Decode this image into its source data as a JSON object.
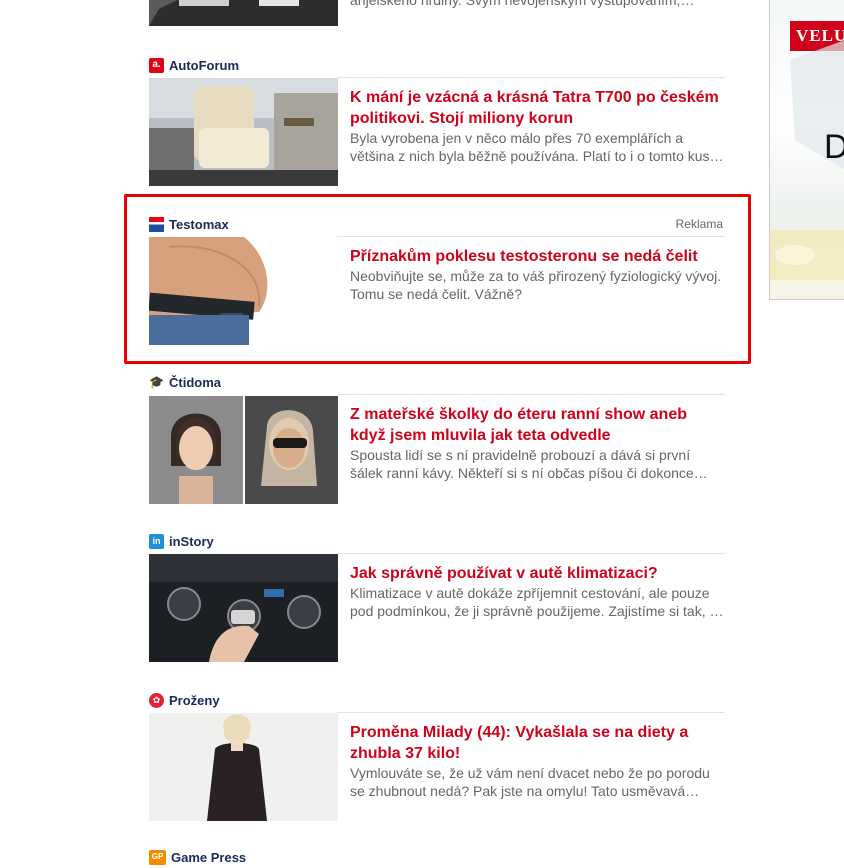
{
  "articles": [
    {
      "source": "",
      "title": "",
      "perex": "anjelského hrdiny. Svým nevojenským vystupováním, lasko…"
    },
    {
      "source": "AutoForum",
      "title": "K mání je vzácná a krásná Tatra T700 po českém politikovi. Stojí miliony korun",
      "perex": "Byla vyrobena jen v něco málo přes 70 exemplářích a většina z nich byla běžně používána. Platí to i o tomto kus…"
    },
    {
      "source": "Testomax",
      "ad_label": "Reklama",
      "title": "Příznakům poklesu testosteronu se nedá čelit",
      "perex": "Neobviňujte se, může za to váš přirozený fyziologický vývoj. Tomu se nedá čelit. Vážně?"
    },
    {
      "source": "Čtidoma",
      "title": "Z mateřské školky do éteru ranní show aneb když jsem mluvila jak teta odvedle",
      "perex": "Spousta lidí se s ní pravidelně probouzí a dává si první šálek ranní kávy. Někteří si s ní občas píšou či dokonce…"
    },
    {
      "source": "inStory",
      "title": "Jak správně používat v autě klimatizaci?",
      "perex": "Klimatizace v autě dokáže zpříjemnit cestování, ale pouze pod podmínkou, že ji správně použijeme. Zajistíme si tak, …"
    },
    {
      "source": "Proženy",
      "title": "Proměna Milady (44): Vykašlala se na diety a zhubla 37 kilo!",
      "perex": "Vymlouváte se, že už vám není dvacet nebo že po porodu se zhubnout nedá? Pak jste na omylu! Tato usměvavá…"
    },
    {
      "source": "Game Press"
    }
  ],
  "icons": {
    "autoforum": "autoforum-logo-icon",
    "testomax": "testomax-flag-icon",
    "ctidoma": "ctidoma-logo-icon",
    "instory": "instory-logo-icon",
    "prozeny": "prozeny-logo-icon",
    "gamepress": "gamepress-logo-icon"
  },
  "side_ad": {
    "brand": "VELU",
    "fragment": "D"
  },
  "colors": {
    "title_red": "#d0021b",
    "highlight_border": "#e60000",
    "source_navy": "#1a2a5a"
  }
}
